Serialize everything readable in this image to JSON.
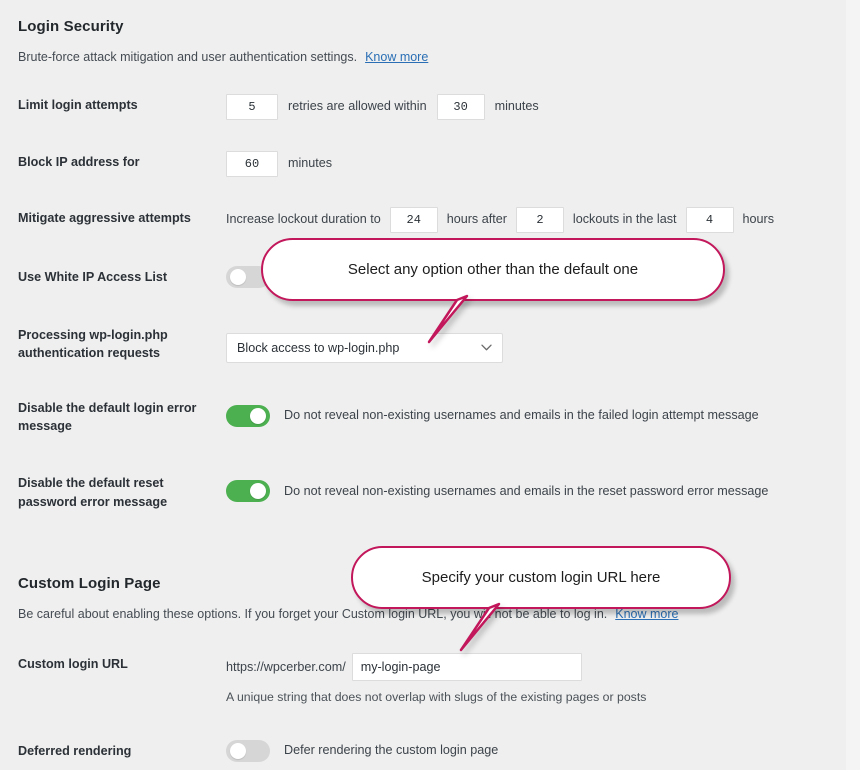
{
  "theme": {
    "background": "#efefef",
    "accent_callout": "#c2185b",
    "toggle_on": "#4caf50",
    "toggle_off": "#d6d6d6",
    "link": "#2a6fb5"
  },
  "login_security": {
    "title": "Login Security",
    "description": "Brute-force attack mitigation and user authentication settings.",
    "know_more": "Know more",
    "limit_login_attempts": {
      "label": "Limit login attempts",
      "retries": "5",
      "mid_text": "retries are allowed within",
      "minutes": "30",
      "suffix": "minutes"
    },
    "block_ip": {
      "label": "Block IP address for",
      "minutes": "60",
      "suffix": "minutes"
    },
    "mitigate": {
      "label": "Mitigate aggressive attempts",
      "prefix": "Increase lockout duration to",
      "duration_hours": "24",
      "mid1": "hours after",
      "lockouts": "2",
      "mid2": "lockouts in the last",
      "last_hours": "4",
      "suffix": "hours"
    },
    "white_ip": {
      "label": "Use White IP Access List",
      "state": "off"
    },
    "wp_login": {
      "label_line1": "Processing wp-login.php",
      "label_line2": "authentication requests",
      "selected": "Block access to wp-login.php",
      "options": [
        "Block access to wp-login.php"
      ]
    },
    "disable_login_error": {
      "label_line1": "Disable the default login error",
      "label_line2": "message",
      "state": "on",
      "caption": "Do not reveal non-existing usernames and emails in the failed login attempt message"
    },
    "disable_reset_error": {
      "label_line1": "Disable the default reset",
      "label_line2": "password error message",
      "state": "on",
      "caption": "Do not reveal non-existing usernames and emails in the reset password error message"
    }
  },
  "custom_login_page": {
    "title": "Custom Login Page",
    "description": "Be careful about enabling these options. If you forget your Custom login URL, you will not be able to log in.",
    "know_more": "Know more",
    "custom_login_url": {
      "label": "Custom login URL",
      "prefix": "https://wpcerber.com/",
      "value": "my-login-page",
      "hint": "A unique string that does not overlap with slugs of the existing pages or posts"
    },
    "deferred_rendering": {
      "label": "Deferred rendering",
      "state": "off",
      "caption": "Defer rendering the custom login page"
    }
  },
  "callouts": [
    {
      "id": "callout-select",
      "text": "Select any option other than the default one"
    },
    {
      "id": "callout-url",
      "text": "Specify your custom login URL here"
    }
  ]
}
